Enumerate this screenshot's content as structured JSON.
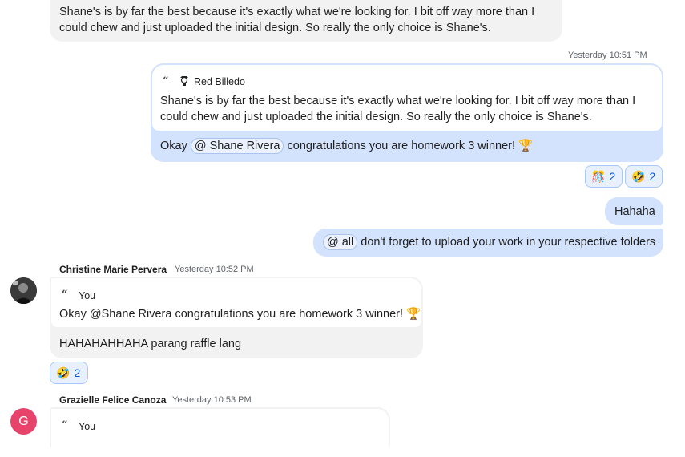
{
  "messages": {
    "top_text": "Shane's is by far the best because it's exactly what we're looking for. I bit off way more than I could chew and just uploaded the initial design. So really the only choice is Shane's.",
    "reply1": {
      "time": "Yesterday 10:51 PM",
      "quote_author": "Red Billedo",
      "quote_text": "Shane's is by far the best because it's exactly what we're looking for. I bit off way more than I could chew and just uploaded the initial design. So really the only choice is Shane's.",
      "text_before": "Okay ",
      "mention": "@ Shane Rivera",
      "text_after": " congratulations you are homework 3 winner! 🏆",
      "reactions": [
        {
          "emoji": "🎊",
          "count": "2"
        },
        {
          "emoji": "🤣",
          "count": "2"
        }
      ]
    },
    "hahaha": "Hahaha",
    "announce": {
      "mention": "@ all",
      "text": " don't forget to upload your work in your respective folders"
    },
    "christine": {
      "sender": "Christine Marie Pervera",
      "time": "Yesterday 10:52 PM",
      "quote_author": "You",
      "quote_text": "Okay @Shane Rivera congratulations you are homework 3 winner! 🏆",
      "text": "HAHAHAHHAHA parang raffle lang",
      "reaction": {
        "emoji": "🤣",
        "count": "2"
      }
    },
    "grazielle": {
      "sender": "Grazielle Felice Canoza",
      "time": "Yesterday 10:53 PM",
      "avatar_letter": "G",
      "quote_author": "You"
    }
  },
  "colors": {
    "outgoing_bubble": "#d3e3fd",
    "incoming_bubble": "#f2f2f2",
    "reaction_border": "#a8c7fa",
    "avatar_g": "#e8436b"
  }
}
